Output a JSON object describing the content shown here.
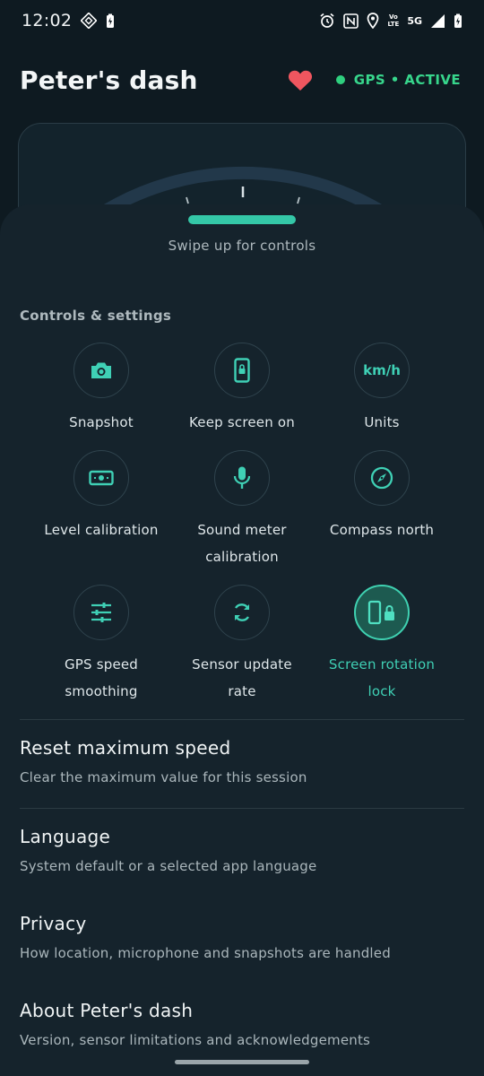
{
  "status_bar": {
    "time": "12:02",
    "network": "5G",
    "volte_top": "Vo",
    "volte_bottom": "LTE",
    "icons": [
      "compass-app-icon",
      "battery-saver-icon",
      "alarm-icon",
      "nfc-icon",
      "location-icon",
      "volte-icon",
      "signal-icon",
      "battery-charging-icon"
    ]
  },
  "header": {
    "title": "Peter's dash",
    "gps_status": "GPS • ACTIVE",
    "favorite_icon": "heart-icon",
    "colors": {
      "accent": "#3fd0b5",
      "gps_green": "#37d68c",
      "heart": "#f0565f"
    }
  },
  "sheet": {
    "swipe_hint": "Swipe up for controls",
    "section_title": "Controls & settings",
    "tiles": [
      {
        "label": "Snapshot",
        "icon": "camera-icon",
        "active": false
      },
      {
        "label": "Keep screen on",
        "icon": "phone-lock-icon",
        "active": false
      },
      {
        "label": "Units",
        "icon": "units-icon",
        "icon_text": "km/h",
        "active": false
      },
      {
        "label": "Level calibration",
        "icon": "level-icon",
        "active": false
      },
      {
        "label_line1": "Sound meter",
        "label_line2": "calibration",
        "icon": "microphone-icon",
        "active": false
      },
      {
        "label": "Compass north",
        "icon": "compass-icon",
        "active": false
      },
      {
        "label_line1": "GPS speed",
        "label_line2": "smoothing",
        "icon": "sliders-icon",
        "active": false
      },
      {
        "label_line1": "Sensor update",
        "label_line2": "rate",
        "icon": "refresh-icon",
        "active": false
      },
      {
        "label_line1": "Screen rotation",
        "label_line2": "lock",
        "icon": "rotation-lock-icon",
        "active": true
      }
    ],
    "rows": [
      {
        "title": "Reset maximum speed",
        "subtitle": "Clear the maximum value for this session"
      },
      {
        "title": "Language",
        "subtitle": "System default or a selected app language"
      },
      {
        "title": "Privacy",
        "subtitle": "How location, microphone and snapshots are handled"
      },
      {
        "title": "About Peter's dash",
        "subtitle": "Version, sensor limitations and acknowledgements"
      }
    ]
  }
}
